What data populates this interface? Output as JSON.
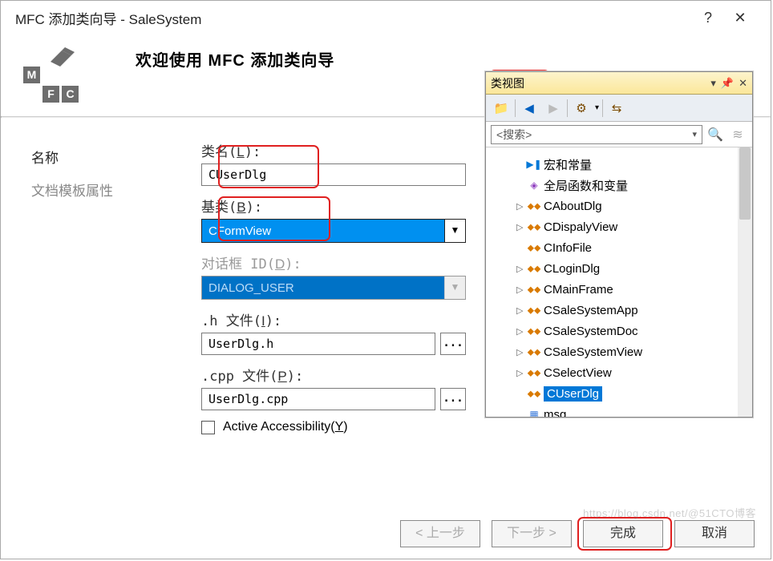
{
  "window": {
    "title": "MFC 添加类向导 - SaleSystem"
  },
  "header": {
    "welcome": "欢迎使用  MFC  添加类向导"
  },
  "sidebar": {
    "items": [
      "名称",
      "文档模板属性"
    ]
  },
  "form": {
    "classname_label": "类名(L):",
    "classname_value": "CUserDlg",
    "base_label": "基类(B):",
    "base_value": "CFormView",
    "dlgid_label": "对话框 ID(D):",
    "dlgid_value": "DIALOG_USER",
    "h_label": ".h 文件(I):",
    "h_value": "UserDlg.h",
    "cpp_label": ".cpp 文件(P):",
    "cpp_value": "UserDlg.cpp",
    "accessibility_label": "Active Accessibility(Y)"
  },
  "footer": {
    "prev": "< 上一步",
    "next": "下一步 >",
    "finish": "完成",
    "cancel": "取消"
  },
  "classview": {
    "title": "类视图",
    "search_placeholder": "<搜索>",
    "items": [
      {
        "label": "宏和常量",
        "icon": "play"
      },
      {
        "label": "全局函数和变量",
        "icon": "cube"
      },
      {
        "label": "CAboutDlg",
        "icon": "class",
        "expander": true
      },
      {
        "label": "CDispalyView",
        "icon": "class",
        "expander": true
      },
      {
        "label": "CInfoFile",
        "icon": "class"
      },
      {
        "label": "CLoginDlg",
        "icon": "class",
        "expander": true
      },
      {
        "label": "CMainFrame",
        "icon": "class",
        "expander": true
      },
      {
        "label": "CSaleSystemApp",
        "icon": "class",
        "expander": true
      },
      {
        "label": "CSaleSystemDoc",
        "icon": "class",
        "expander": true
      },
      {
        "label": "CSaleSystemView",
        "icon": "class",
        "expander": true
      },
      {
        "label": "CSelectView",
        "icon": "class",
        "expander": true
      },
      {
        "label": "CUserDlg",
        "icon": "class",
        "selected": true
      },
      {
        "label": "msg",
        "icon": "struct"
      }
    ]
  },
  "watermark": "https://blog.csdn.net/@51CTO博客"
}
